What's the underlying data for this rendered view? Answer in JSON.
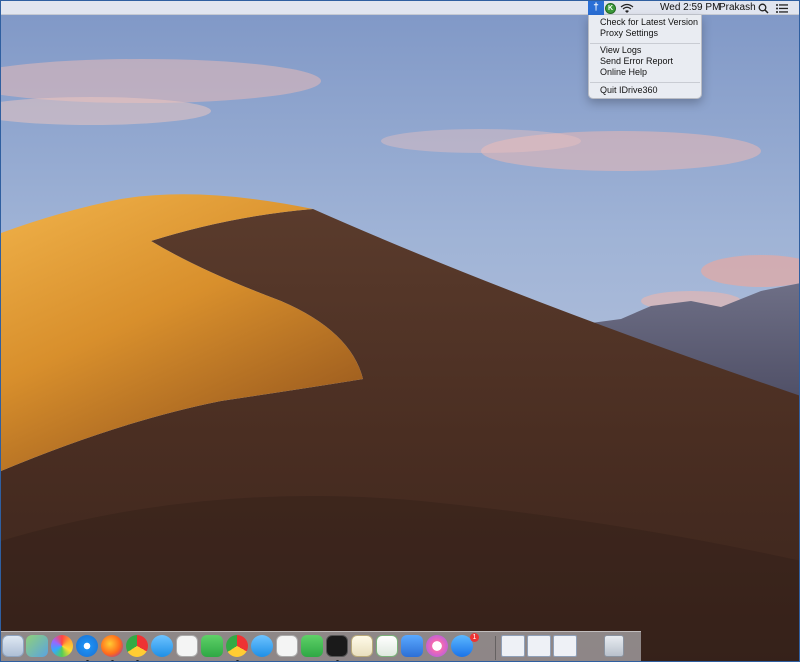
{
  "menubar": {
    "clock": "Wed 2:59 PM",
    "user": "Prakash",
    "status_icons": [
      "idrive-icon",
      "extension-icon",
      "wifi-icon",
      "spotlight-icon",
      "notification-center-icon"
    ]
  },
  "idrive_menu": {
    "items": [
      {
        "label": "Check for Latest Version"
      },
      {
        "label": "Proxy Settings"
      },
      {
        "label": "View Logs"
      },
      {
        "label": "Send Error Report"
      },
      {
        "label": "Online Help"
      },
      {
        "label": "Quit IDrive360"
      }
    ]
  },
  "dock": {
    "apps": [
      "finder-icon",
      "maps-icon",
      "photos-icon",
      "safari-icon",
      "firefox-icon",
      "chrome-icon",
      "messages-icon",
      "app-icon",
      "facetime-icon",
      "chrome-icon",
      "messages-icon",
      "app-icon",
      "facetime-icon",
      "terminal-icon",
      "textedit-icon",
      "numbers-icon",
      "keynote-icon",
      "itunes-icon",
      "app-store-icon",
      "window-icon",
      "window-icon",
      "window-icon",
      "trash-icon"
    ],
    "app_store_badge": "1"
  },
  "colors": {
    "accent": "#2a6fd6",
    "sky_top": "#8fa8cf",
    "dune_light": "#e0a23a",
    "dune_dark": "#4a2f24"
  }
}
